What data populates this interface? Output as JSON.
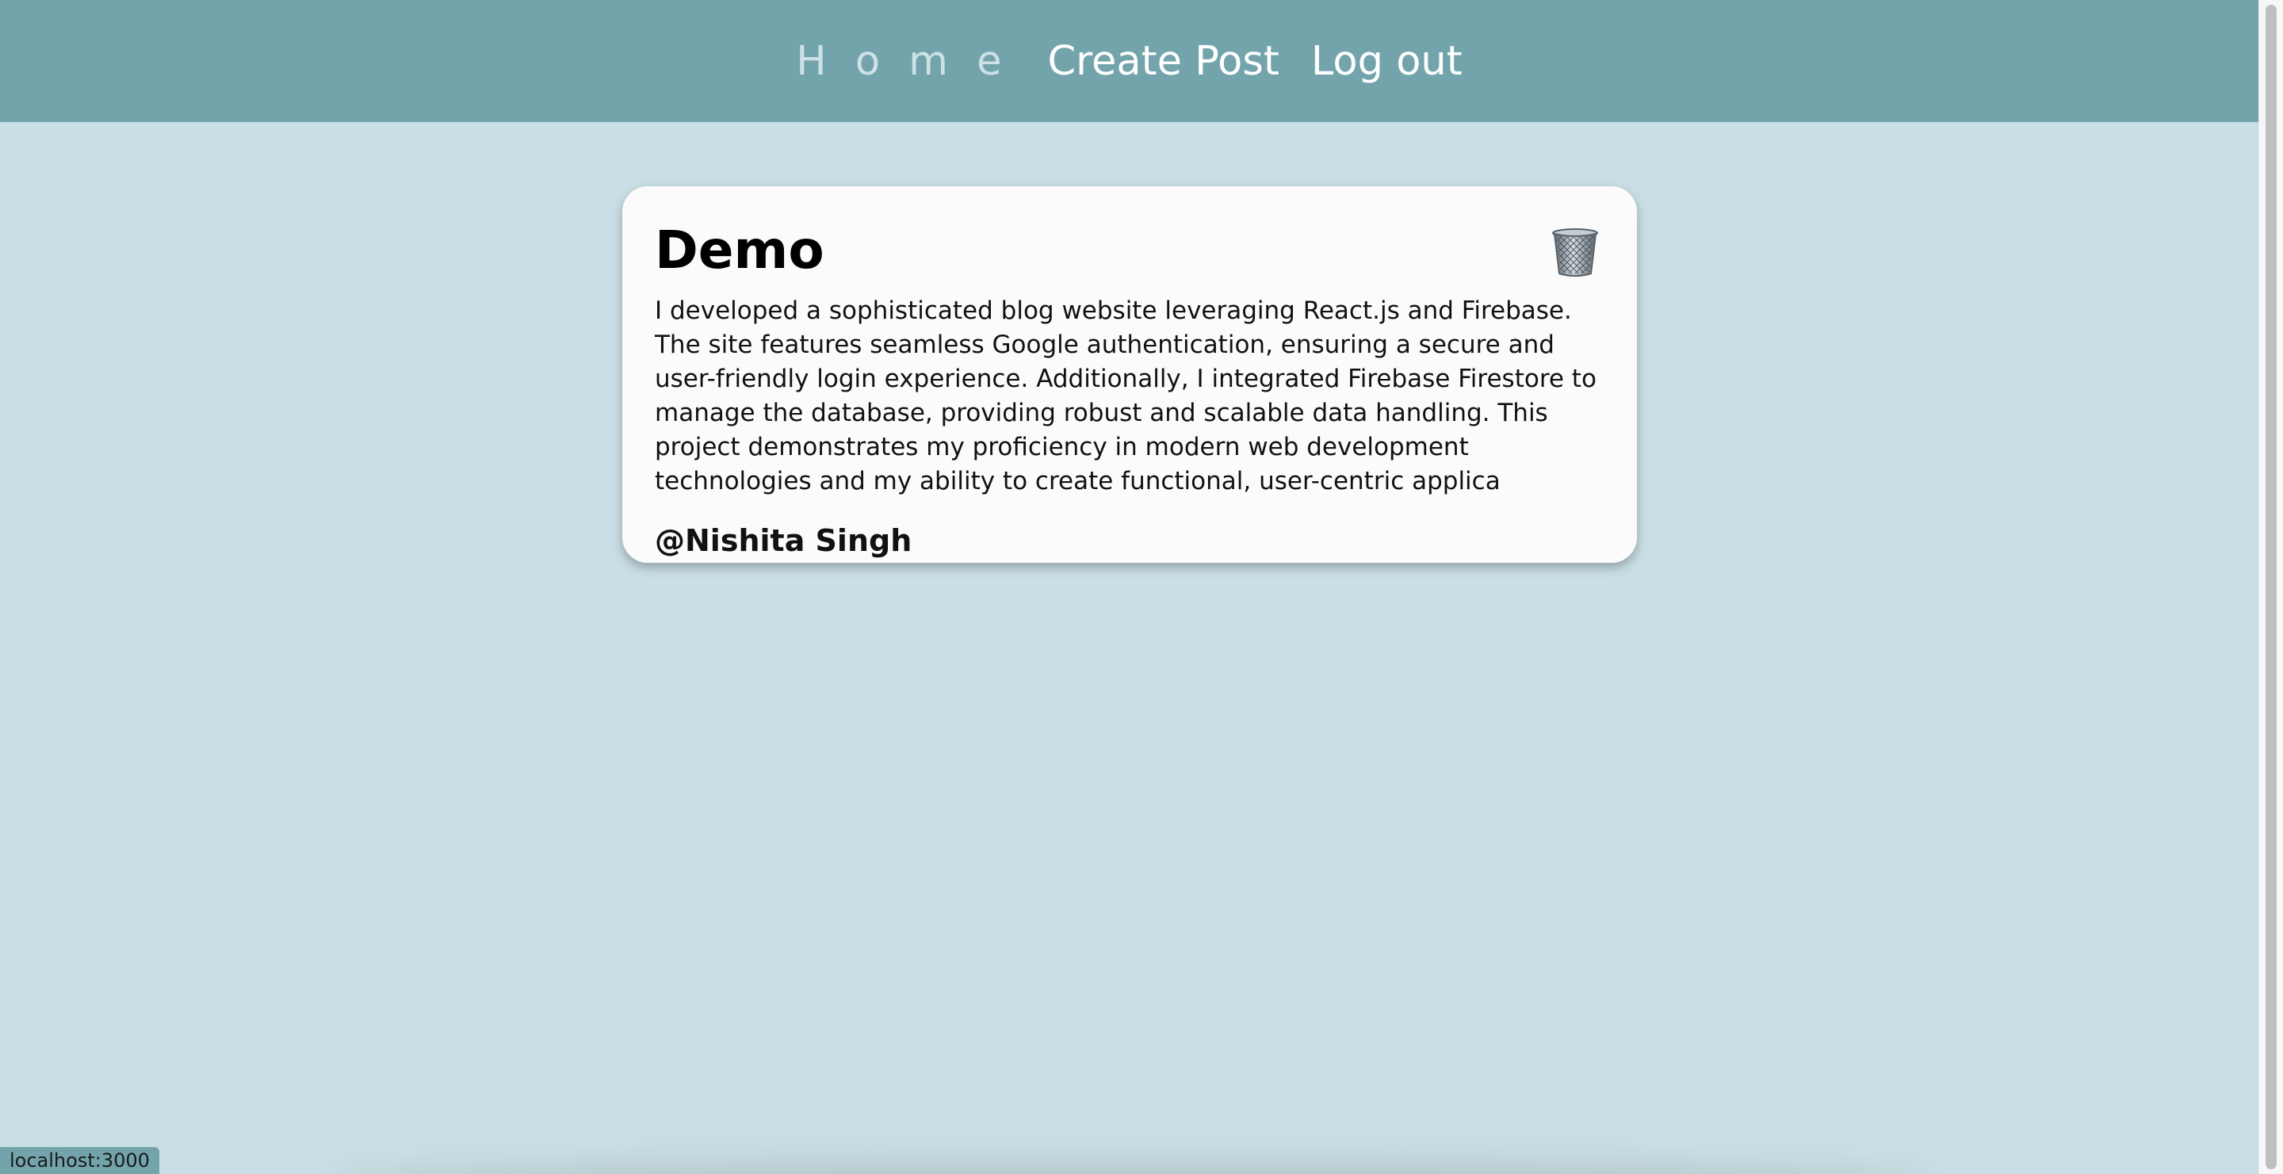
{
  "nav": {
    "home": "H o m e",
    "create_post": "Create Post",
    "log_out": "Log out"
  },
  "post": {
    "title": "Demo",
    "body": "I developed a sophisticated blog website leveraging React.js and Firebase. The site features seamless Google authentication, ensuring a secure and user-friendly login experience. Additionally, I integrated Firebase Firestore to manage the database, providing robust and scalable data handling. This project demonstrates my proficiency in modern web development technologies and my ability to create functional, user-centric applica",
    "author": "@Nishita Singh",
    "delete_icon": "trash-icon"
  },
  "status_bar": {
    "url": "localhost:3000"
  },
  "colors": {
    "background": "#cadfe5",
    "navbar": "#73a4ac",
    "card": "#fbfbfb",
    "home_link": "#cde1e6",
    "nav_link": "#ffffff"
  }
}
